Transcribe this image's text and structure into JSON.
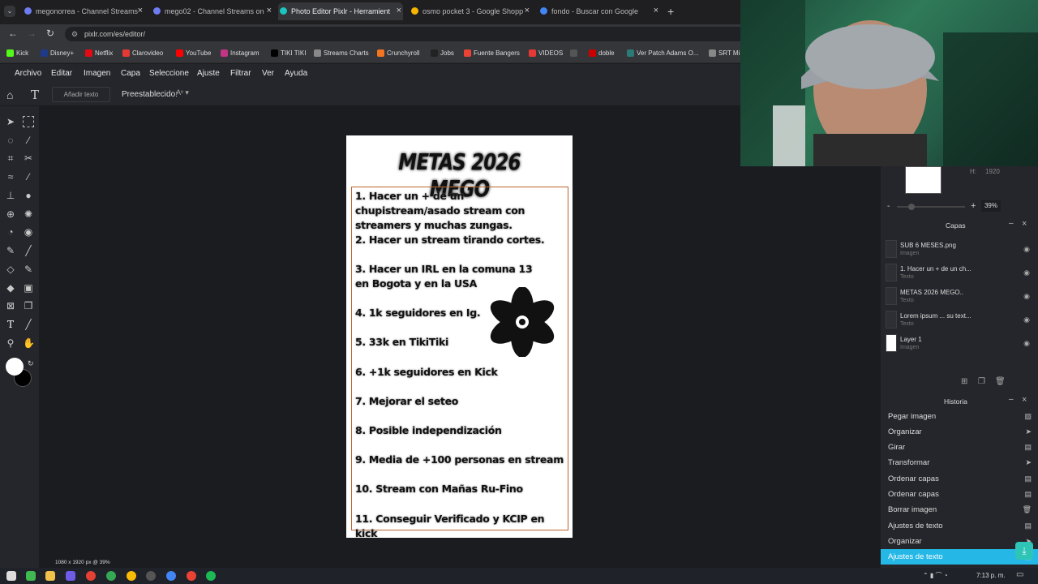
{
  "browser": {
    "tabs": [
      {
        "title": "megonorrea - Channel Streams",
        "color": "#6e7cf2"
      },
      {
        "title": "mego02 - Channel Streams on",
        "color": "#6e7cf2"
      },
      {
        "title": "Photo Editor Pixlr - Herramient",
        "color": "#19c7c0"
      },
      {
        "title": "osmo pocket 3 - Google Shopp",
        "color": "#f4b400"
      },
      {
        "title": "fondo - Buscar con Google",
        "color": "#4285f4"
      }
    ],
    "url": "pixlr.com/es/editor/",
    "bookmarks": [
      {
        "label": "Kick",
        "color": "#53fc18"
      },
      {
        "label": "Disney+",
        "color": "#1e3a8a"
      },
      {
        "label": "Netflix",
        "color": "#e50914"
      },
      {
        "label": "Clarovideo",
        "color": "#e53935"
      },
      {
        "label": "YouTube",
        "color": "#ff0000"
      },
      {
        "label": "Instagram",
        "color": "#c13584"
      },
      {
        "label": "TIKI TIKI",
        "color": "#000000"
      },
      {
        "label": "Streams Charts",
        "color": "#888888"
      },
      {
        "label": "Crunchyroll",
        "color": "#f47521"
      },
      {
        "label": "Jobs",
        "color": "#222222"
      },
      {
        "label": "Fuente Bangers",
        "color": "#ea4335"
      },
      {
        "label": "VIDEOS",
        "color": "#e53935"
      },
      {
        "label": "doble",
        "color": "#cc0000"
      },
      {
        "label": "Ver Patch Adams O...",
        "color": "#2b7a78"
      },
      {
        "label": "SRT Mi",
        "color": "#888888"
      }
    ]
  },
  "menu": [
    "Archivo",
    "Editar",
    "Imagen",
    "Capa",
    "Seleccione",
    "Ajuste",
    "Filtrar",
    "Ver",
    "Ayuda"
  ],
  "toolbar": {
    "add_text": "Añadir texto",
    "preset_label": "Preestablecido:"
  },
  "canvas": {
    "title": "METAS 2026 MEGO",
    "goals": [
      "1. Hacer un + de un chupistream/asado stream con streamers y muchas zungas.",
      "2. Hacer un stream tirando cortes.",
      "3. Hacer un IRL en la comuna 13 en Bogota y en la USA",
      "4. 1k seguidores en Ig.",
      "5. 33k en TikiTiki",
      "6. +1k seguidores en Kick",
      "7. Mejorar el seteo",
      "8. Posible independización",
      "9. Media de +100 personas en stream",
      "10. Stream con Mañas Ru-Fino",
      "11. Conseguir Verificado y KCIP en kick"
    ]
  },
  "status": "1080 x 1920 px @ 39%",
  "navigator": {
    "height_label": "H:",
    "height_value": "1920",
    "zoom": "39%"
  },
  "layers_panel": {
    "title": "Capas",
    "layers": [
      {
        "name": "SUB 6 MESES.png",
        "type": "Imagen"
      },
      {
        "name": "1. Hacer un + de un ch...",
        "type": "Texto"
      },
      {
        "name": "METAS 2026 MEGO..",
        "type": "Texto"
      },
      {
        "name": "Lorem ipsum ... su text...",
        "type": "Texto"
      },
      {
        "name": "Layer 1",
        "type": "Imagen"
      }
    ]
  },
  "history_panel": {
    "title": "Historia",
    "items": [
      {
        "label": "Pegar imagen",
        "icon": "image-icon"
      },
      {
        "label": "Organizar",
        "icon": "pointer-icon"
      },
      {
        "label": "Girar",
        "icon": "doc-icon"
      },
      {
        "label": "Transformar",
        "icon": "pointer-icon"
      },
      {
        "label": "Ordenar capas",
        "icon": "doc-icon"
      },
      {
        "label": "Ordenar capas",
        "icon": "doc-icon"
      },
      {
        "label": "Borrar imagen",
        "icon": "trash-icon"
      },
      {
        "label": "Ajustes de texto",
        "icon": "doc-icon"
      },
      {
        "label": "Organizar",
        "icon": "pointer-icon"
      },
      {
        "label": "Ajustes de texto",
        "icon": "doc-icon",
        "active": true
      }
    ]
  },
  "taskbar": {
    "time": "7:13 p. m."
  }
}
